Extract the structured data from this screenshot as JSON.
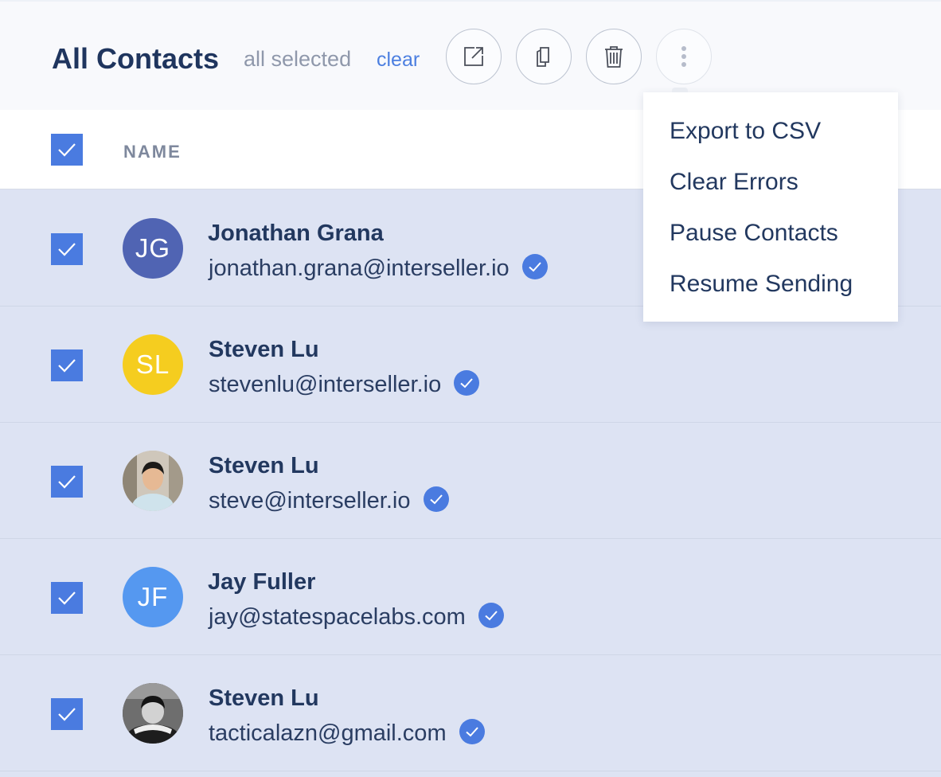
{
  "header": {
    "title": "All Contacts",
    "selection_status": "all selected",
    "clear_label": "clear",
    "actions": [
      "export-icon",
      "copy-icon",
      "trash-icon",
      "more-vertical-icon"
    ]
  },
  "table": {
    "name_column": "NAME",
    "select_all_checked": true
  },
  "dropdown_menu": {
    "items": [
      "Export to CSV",
      "Clear Errors",
      "Pause Contacts",
      "Resume Sending"
    ]
  },
  "contacts": [
    {
      "name": "Jonathan Grana",
      "email": "jonathan.grana@interseller.io",
      "initials": "JG",
      "avatar_color": "#5064b3",
      "checked": true,
      "verified": true
    },
    {
      "name": "Steven Lu",
      "email": "stevenlu@interseller.io",
      "initials": "SL",
      "avatar_color": "#f5cd1f",
      "checked": true,
      "verified": true
    },
    {
      "name": "Steven Lu",
      "email": "steve@interseller.io",
      "avatar_type": "photo",
      "checked": true,
      "verified": true
    },
    {
      "name": "Jay Fuller",
      "email": "jay@statespacelabs.com",
      "initials": "JF",
      "avatar_color": "#5598f0",
      "checked": true,
      "verified": true
    },
    {
      "name": "Steven Lu",
      "email": "tacticalazn@gmail.com",
      "avatar_type": "photo",
      "checked": true,
      "verified": true
    }
  ],
  "colors": {
    "accent": "#4a7be0",
    "selected_row_bg": "#dde3f3",
    "header_bg": "#f8f9fc",
    "text_primary": "#22385f",
    "link": "#4c7fe0"
  }
}
